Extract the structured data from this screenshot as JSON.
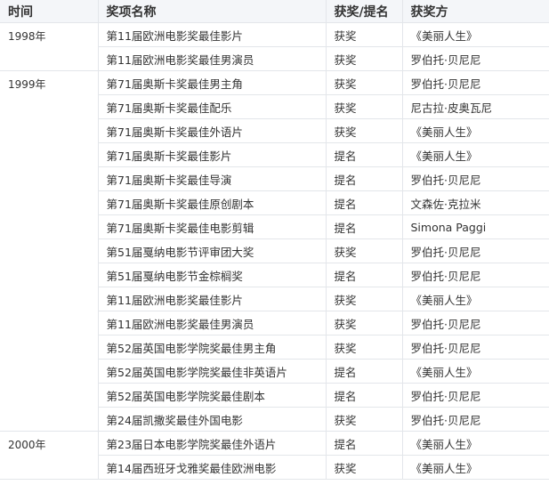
{
  "headers": [
    "时间",
    "奖项名称",
    "获奖/提名",
    "获奖方"
  ],
  "groups": [
    {
      "year": "1998年",
      "rows": [
        [
          "第11届欧洲电影奖最佳影片",
          "获奖",
          "《美丽人生》"
        ],
        [
          "第11届欧洲电影奖最佳男演员",
          "获奖",
          "罗伯托·贝尼尼"
        ]
      ]
    },
    {
      "year": "1999年",
      "rows": [
        [
          "第71届奥斯卡奖最佳男主角",
          "获奖",
          "罗伯托·贝尼尼"
        ],
        [
          "第71届奥斯卡奖最佳配乐",
          "获奖",
          "尼古拉·皮奥瓦尼"
        ],
        [
          "第71届奥斯卡奖最佳外语片",
          "获奖",
          "《美丽人生》"
        ],
        [
          "第71届奥斯卡奖最佳影片",
          "提名",
          "《美丽人生》"
        ],
        [
          "第71届奥斯卡奖最佳导演",
          "提名",
          "罗伯托·贝尼尼"
        ],
        [
          "第71届奥斯卡奖最佳原创剧本",
          "提名",
          "文森佐·克拉米"
        ],
        [
          "第71届奥斯卡奖最佳电影剪辑",
          "提名",
          "Simona Paggi"
        ],
        [
          "第51届戛纳电影节评审团大奖",
          "获奖",
          "罗伯托·贝尼尼"
        ],
        [
          "第51届戛纳电影节金棕榈奖",
          "提名",
          "罗伯托·贝尼尼"
        ],
        [
          "第11届欧洲电影奖最佳影片",
          "获奖",
          "《美丽人生》"
        ],
        [
          "第11届欧洲电影奖最佳男演员",
          "获奖",
          "罗伯托·贝尼尼"
        ],
        [
          "第52届英国电影学院奖最佳男主角",
          "获奖",
          "罗伯托·贝尼尼"
        ],
        [
          "第52届英国电影学院奖最佳非英语片",
          "提名",
          "《美丽人生》"
        ],
        [
          "第52届英国电影学院奖最佳剧本",
          "提名",
          "罗伯托·贝尼尼"
        ],
        [
          "第24届凯撒奖最佳外国电影",
          "获奖",
          "罗伯托·贝尼尼"
        ]
      ]
    },
    {
      "year": "2000年",
      "rows": [
        [
          "第23届日本电影学院奖最佳外语片",
          "提名",
          "《美丽人生》"
        ],
        [
          "第14届西班牙戈雅奖最佳欧洲电影",
          "获奖",
          "《美丽人生》"
        ]
      ]
    }
  ]
}
